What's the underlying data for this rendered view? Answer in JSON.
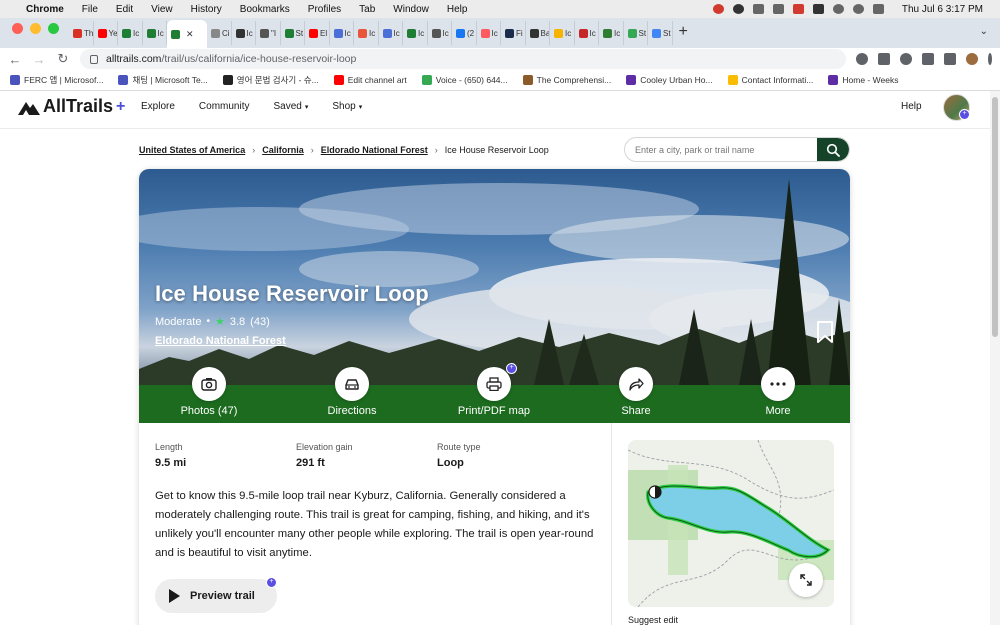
{
  "macbar": {
    "app": "Chrome",
    "menus": [
      "File",
      "Edit",
      "View",
      "History",
      "Bookmarks",
      "Profiles",
      "Tab",
      "Window",
      "Help"
    ],
    "clock": "Thu Jul 6  3:17 PM"
  },
  "tabs": [
    {
      "label": "Th",
      "color": "#d93025"
    },
    {
      "label": "Ye",
      "color": "#ff0000"
    },
    {
      "label": "Ic",
      "color": "#1e7e34"
    },
    {
      "label": "Ic",
      "color": "#1e7e34"
    },
    {
      "label": "",
      "color": "#1e7e34",
      "active": true
    },
    {
      "label": "Ci",
      "color": "#888888"
    },
    {
      "label": "Ic",
      "color": "#333333"
    },
    {
      "label": "\"I",
      "color": "#555555"
    },
    {
      "label": "St",
      "color": "#1e7e34"
    },
    {
      "label": "El",
      "color": "#ff0000"
    },
    {
      "label": "Ic",
      "color": "#4a6fd8"
    },
    {
      "label": "Ic",
      "color": "#e8553a"
    },
    {
      "label": "Ic",
      "color": "#4a6fd8"
    },
    {
      "label": "Ic",
      "color": "#1e7e34"
    },
    {
      "label": "Ic",
      "color": "#555555"
    },
    {
      "label": "(2",
      "color": "#1877f2"
    },
    {
      "label": "Ic",
      "color": "#ff5a5f"
    },
    {
      "label": "Fi",
      "color": "#1a2b4c"
    },
    {
      "label": "Ba",
      "color": "#333333"
    },
    {
      "label": "Ic",
      "color": "#f5b400"
    },
    {
      "label": "Ic",
      "color": "#c62828"
    },
    {
      "label": "Ic",
      "color": "#2e7d32"
    },
    {
      "label": "St",
      "color": "#34a853"
    },
    {
      "label": "St",
      "color": "#4285f4"
    }
  ],
  "address": {
    "host": "alltrails.com",
    "path": "/trail/us/california/ice-house-reservoir-loop"
  },
  "bookmarks": [
    {
      "label": "FERC 앱 | Microsof...",
      "color": "#4b53bc"
    },
    {
      "label": "채팅 | Microsoft Te...",
      "color": "#4b53bc"
    },
    {
      "label": "영어 문법 검사기 - 슈...",
      "color": "#222222"
    },
    {
      "label": "Edit channel art",
      "color": "#ff0000"
    },
    {
      "label": "Voice - (650) 644...",
      "color": "#34a853"
    },
    {
      "label": "The Comprehensi...",
      "color": "#8a5a2b"
    },
    {
      "label": "Cooley Urban Ho...",
      "color": "#5e2ca5"
    },
    {
      "label": "Contact Informati...",
      "color": "#fbbc04"
    },
    {
      "label": "Home - Weeks",
      "color": "#5e2ca5"
    }
  ],
  "site": {
    "logo_text": "AllTrails",
    "logo_plus": "+",
    "nav": [
      {
        "label": "Explore",
        "dropdown": false
      },
      {
        "label": "Community",
        "dropdown": false
      },
      {
        "label": "Saved",
        "dropdown": true
      },
      {
        "label": "Shop",
        "dropdown": true
      }
    ],
    "help": "Help"
  },
  "breadcrumb": [
    "United States of America",
    "California",
    "Eldorado National Forest",
    "Ice House Reservoir Loop"
  ],
  "search": {
    "placeholder": "Enter a city, park or trail name"
  },
  "trail": {
    "title": "Ice House Reservoir Loop",
    "difficulty": "Moderate",
    "rating": "3.8",
    "review_count": "(43)",
    "park": "Eldorado National Forest",
    "length_label": "Length",
    "length_value": "9.5 mi",
    "elev_label": "Elevation gain",
    "elev_value": "291 ft",
    "route_label": "Route type",
    "route_value": "Loop",
    "description": "Get to know this 9.5-mile loop trail near Kyburz, California. Generally considered a moderately challenging route. This trail is great for camping, fishing, and hiking, and it's unlikely you'll encounter many other people while exploring. The trail is open year-round and is beautiful to visit anytime.",
    "preview_label": "Preview trail",
    "suggest_edit": "Suggest edit"
  },
  "actions": [
    "Photos (47)",
    "Directions",
    "Print/PDF map",
    "Share",
    "More"
  ],
  "colors": {
    "brand_green": "#14432a",
    "action_green": "#1c6b1f",
    "plus_purple": "#5b4ee3",
    "trail_green": "#2ecc40",
    "lake_blue": "#7ccfe6"
  }
}
